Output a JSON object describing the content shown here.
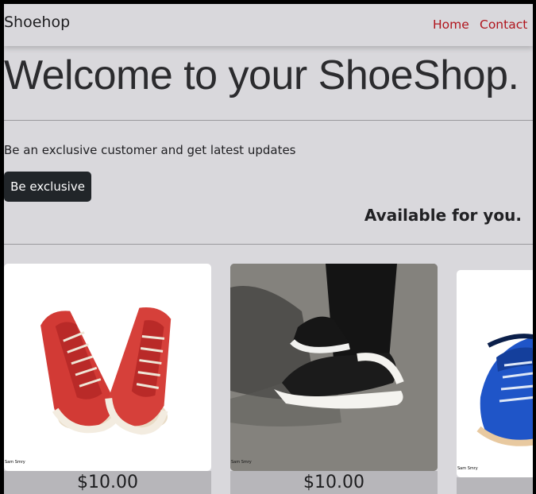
{
  "navbar": {
    "brand": "Shoehop",
    "links": [
      {
        "label": "Home"
      },
      {
        "label": "Contact"
      }
    ],
    "link_color": "#b0141c"
  },
  "hero": {
    "title": "Welcome to your ShoeShop.",
    "lead": "Be an exclusive customer and get latest updates",
    "cta_label": "Be exclusive"
  },
  "section_title": "Available for you.",
  "products": [
    {
      "price": "$10.00",
      "image": "red-sneakers",
      "caption": "Sam Smry"
    },
    {
      "price": "$10.00",
      "image": "black-white-sneakers",
      "caption": "Sam Smry"
    },
    {
      "price": "",
      "image": "blue-running-shoe",
      "caption": "Sam Smry"
    }
  ],
  "colors": {
    "background": "#d9d8dc",
    "button": "#212529",
    "accent": "#b0141c"
  }
}
